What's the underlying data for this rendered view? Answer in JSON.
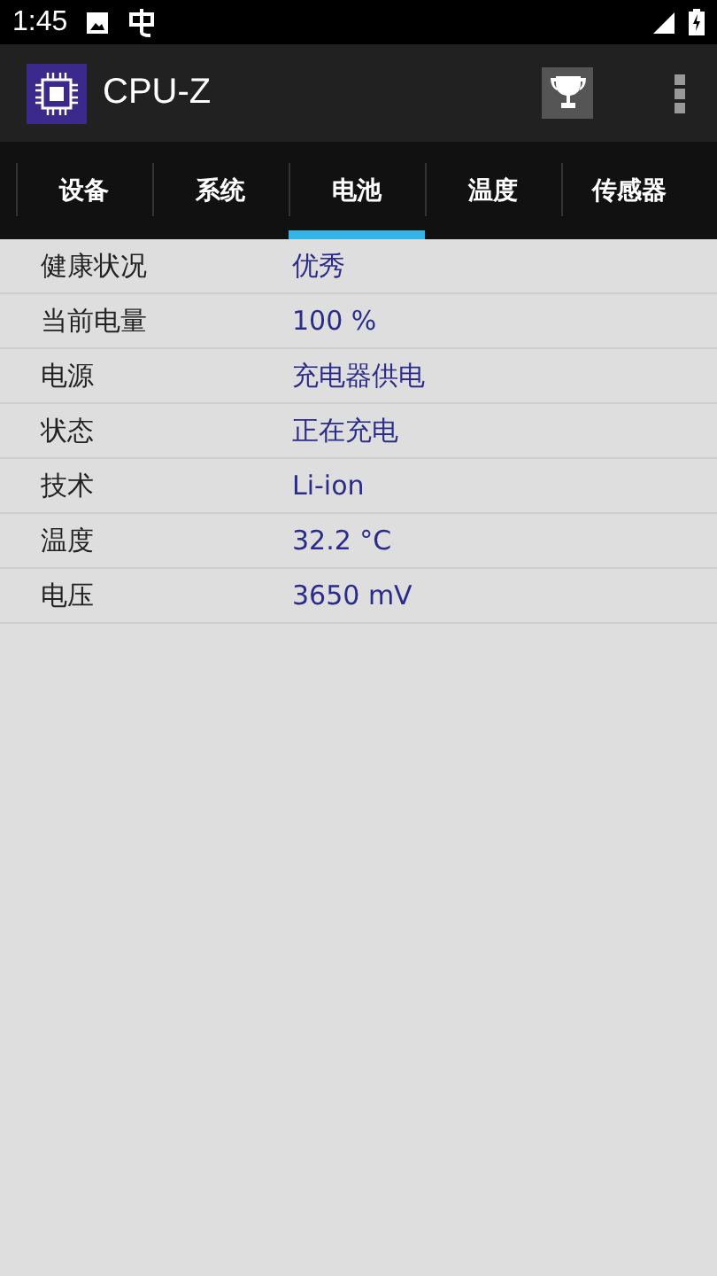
{
  "status_bar": {
    "time": "1:45"
  },
  "app_bar": {
    "title": "CPU-Z"
  },
  "tabs": [
    {
      "label": "设备",
      "selected": false
    },
    {
      "label": "系统",
      "selected": false
    },
    {
      "label": "电池",
      "selected": true
    },
    {
      "label": "温度",
      "selected": false
    },
    {
      "label": "传感器",
      "selected": false
    }
  ],
  "rows": [
    {
      "label": "健康状况",
      "value": "优秀"
    },
    {
      "label": "当前电量",
      "value": "100 %"
    },
    {
      "label": "电源",
      "value": "充电器供电"
    },
    {
      "label": "状态",
      "value": "正在充电"
    },
    {
      "label": "技术",
      "value": "Li-ion"
    },
    {
      "label": "温度",
      "value": "32.2 °C"
    },
    {
      "label": "电压",
      "value": "3650 mV"
    }
  ]
}
